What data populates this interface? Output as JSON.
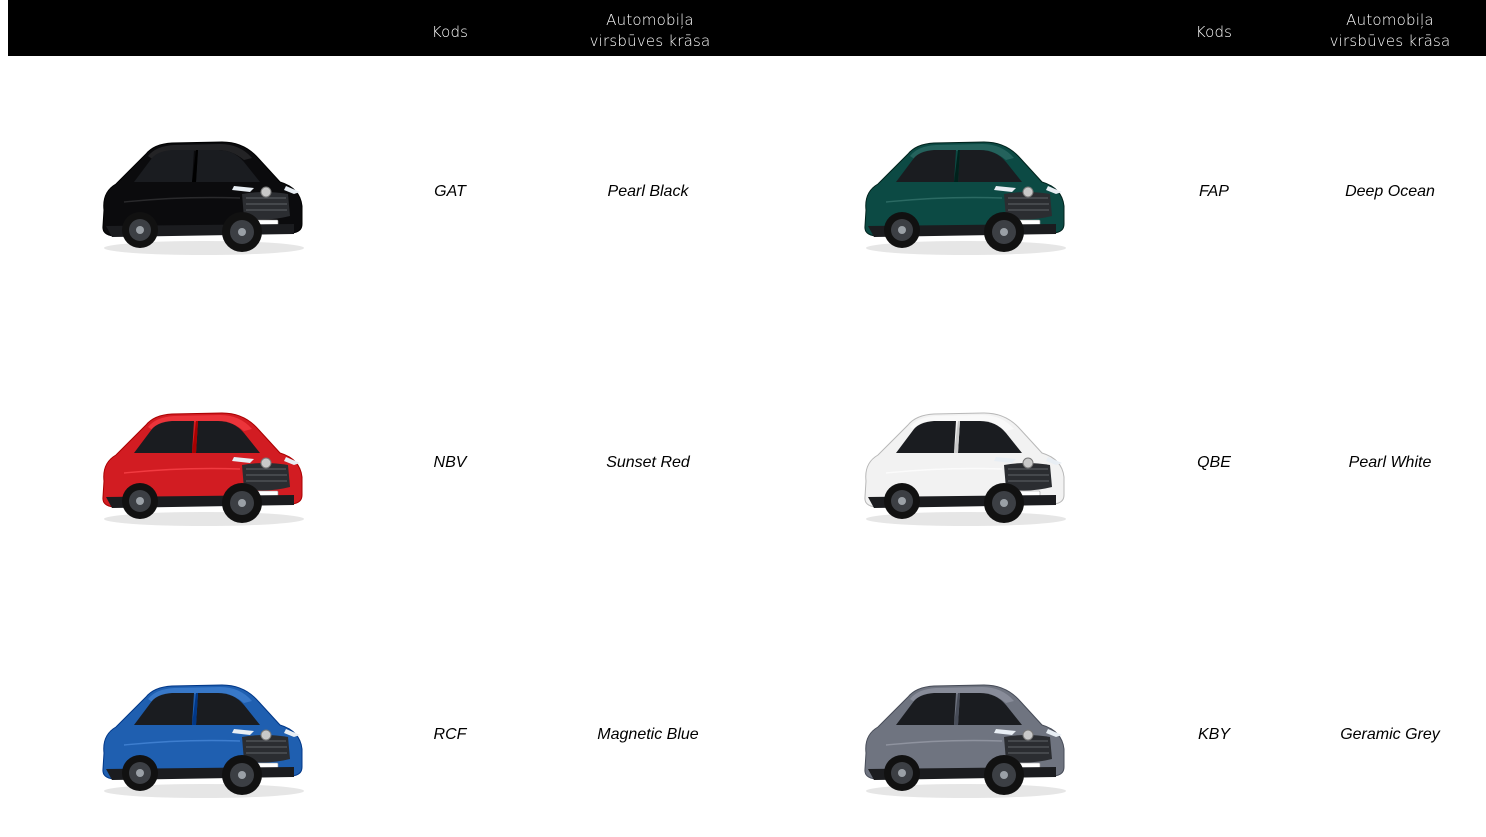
{
  "header": {
    "left": {
      "code_label": "Kods",
      "color_label_line1": "Automobiļa",
      "color_label_line2": "virsbūves krāsa"
    },
    "right": {
      "code_label": "Kods",
      "color_label_line1": "Automobiļa",
      "color_label_line2": "virsbūves krāsa"
    }
  },
  "rows": [
    {
      "left": {
        "code": "GAT",
        "color_name": "Pearl Black",
        "paint": "#0b0b0d",
        "image_icon": "car-icon"
      },
      "right": {
        "code": "FAP",
        "color_name": "Deep Ocean",
        "paint": "#0c4a44",
        "image_icon": "car-icon"
      }
    },
    {
      "left": {
        "code": "NBV",
        "color_name": "Sunset Red",
        "paint": "#d21c22",
        "image_icon": "car-icon"
      },
      "right": {
        "code": "QBE",
        "color_name": "Pearl White",
        "paint": "#f2f2f2",
        "image_icon": "car-icon"
      }
    },
    {
      "left": {
        "code": "RCF",
        "color_name": "Magnetic Blue",
        "paint": "#1f5fb0",
        "image_icon": "car-icon"
      },
      "right": {
        "code": "KBY",
        "color_name": "Geramic Grey",
        "paint": "#6f7480",
        "image_icon": "car-icon"
      }
    }
  ]
}
